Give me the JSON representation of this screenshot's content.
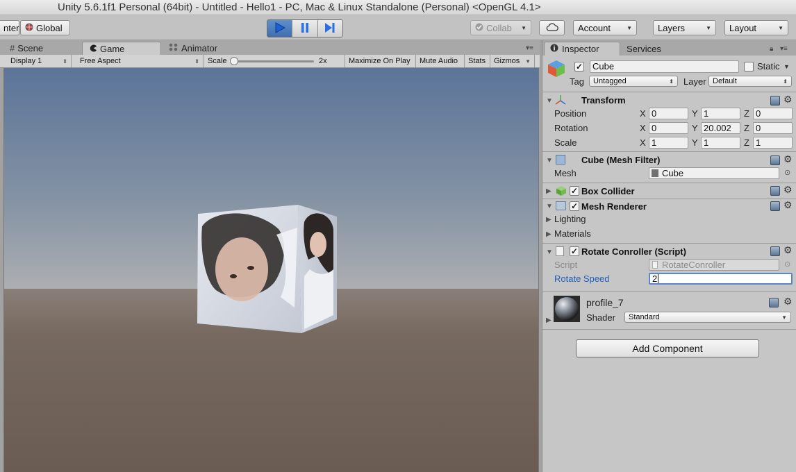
{
  "window": {
    "title": "Unity 5.6.1f1 Personal (64bit) - Untitled - Hello1 - PC, Mac & Linux Standalone (Personal) <OpenGL 4.1>"
  },
  "toolbar": {
    "pivot_label": "nter",
    "global_label": "Global",
    "collab_label": "Collab",
    "account_label": "Account",
    "layers_label": "Layers",
    "layout_label": "Layout"
  },
  "game_panel": {
    "tabs": [
      {
        "label": "Scene"
      },
      {
        "label": "Game"
      },
      {
        "label": "Animator"
      }
    ],
    "display_label": "Display 1",
    "aspect_label": "Free Aspect",
    "scale_label": "Scale",
    "scale_value": "2x",
    "maximize_label": "Maximize On Play",
    "mute_label": "Mute Audio",
    "stats_label": "Stats",
    "gizmos_label": "Gizmos"
  },
  "inspector": {
    "tabs": [
      {
        "label": "Inspector"
      },
      {
        "label": "Services"
      }
    ],
    "object_name": "Cube",
    "static_label": "Static",
    "tag_label": "Tag",
    "tag_value": "Untagged",
    "layer_label": "Layer",
    "layer_value": "Default",
    "transform": {
      "title": "Transform",
      "rows": [
        {
          "label": "Position",
          "x": "0",
          "y": "1",
          "z": "0"
        },
        {
          "label": "Rotation",
          "x": "0",
          "y": "20.002",
          "z": "0"
        },
        {
          "label": "Scale",
          "x": "1",
          "y": "1",
          "z": "1"
        }
      ],
      "axis_x": "X",
      "axis_y": "Y",
      "axis_z": "Z"
    },
    "mesh_filter": {
      "title": "Cube (Mesh Filter)",
      "mesh_label": "Mesh",
      "mesh_value": "Cube"
    },
    "box_collider": {
      "title": "Box Collider"
    },
    "mesh_renderer": {
      "title": "Mesh Renderer",
      "lighting_label": "Lighting",
      "materials_label": "Materials"
    },
    "rotate_controller": {
      "title": "Rotate Conroller (Script)",
      "script_label": "Script",
      "script_value": "RotateConroller",
      "speed_label": "Rotate Speed",
      "speed_value": "2"
    },
    "material": {
      "name": "profile_7",
      "shader_label": "Shader",
      "shader_value": "Standard"
    },
    "add_component_label": "Add Component"
  }
}
